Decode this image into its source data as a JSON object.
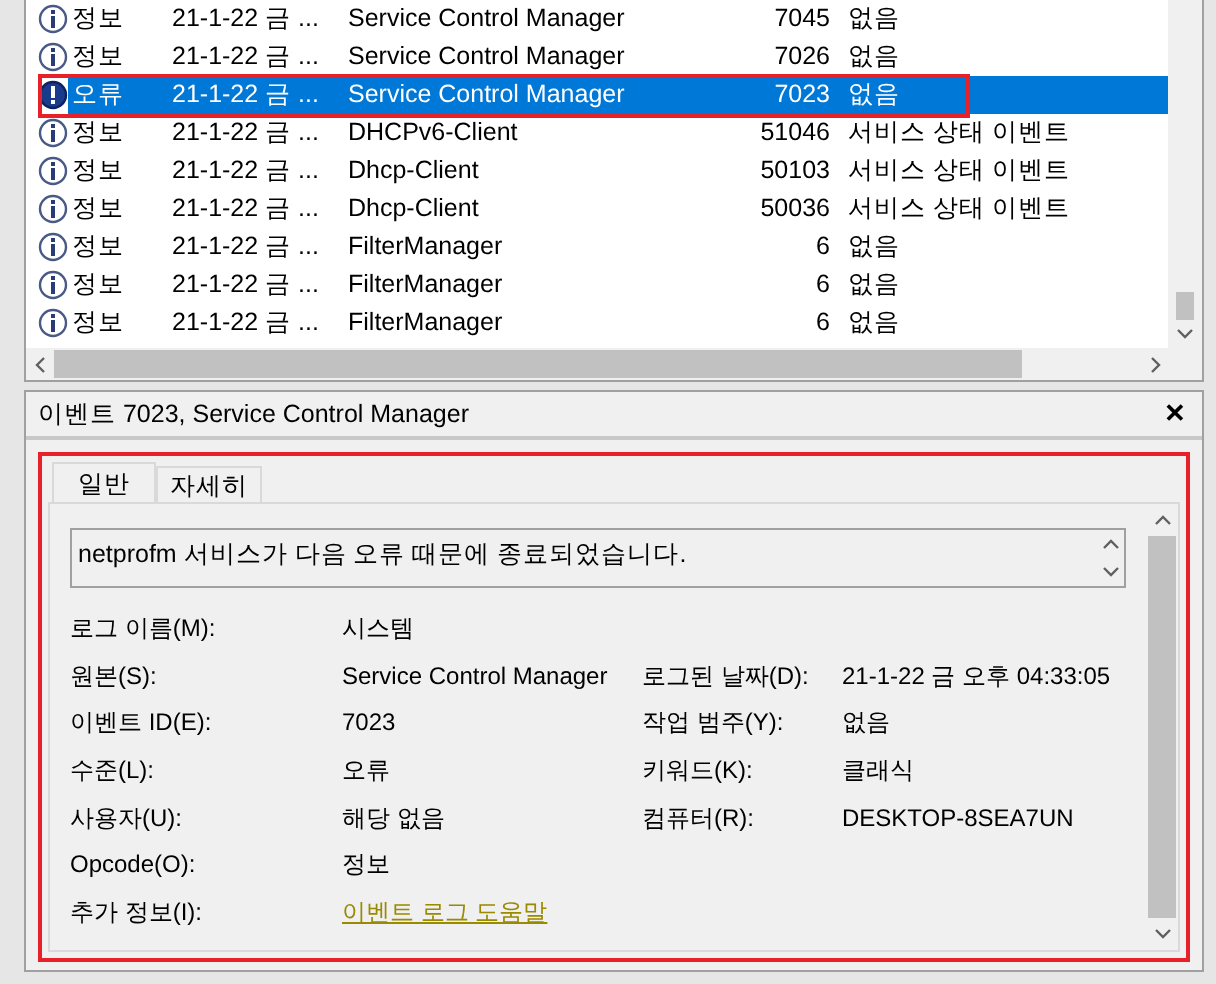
{
  "event_list": {
    "rows": [
      {
        "kind": "info",
        "level": "정보",
        "date": "21-1-22 금 ...",
        "source": "Service Control Manager",
        "event_id": "7045",
        "category": "없음",
        "selected": false
      },
      {
        "kind": "info",
        "level": "정보",
        "date": "21-1-22 금 ...",
        "source": "Service Control Manager",
        "event_id": "7026",
        "category": "없음",
        "selected": false
      },
      {
        "kind": "error",
        "level": "오류",
        "date": "21-1-22 금 ...",
        "source": "Service Control Manager",
        "event_id": "7023",
        "category": "없음",
        "selected": true
      },
      {
        "kind": "info",
        "level": "정보",
        "date": "21-1-22 금 ...",
        "source": "DHCPv6-Client",
        "event_id": "51046",
        "category": "서비스 상태 이벤트",
        "selected": false
      },
      {
        "kind": "info",
        "level": "정보",
        "date": "21-1-22 금 ...",
        "source": "Dhcp-Client",
        "event_id": "50103",
        "category": "서비스 상태 이벤트",
        "selected": false
      },
      {
        "kind": "info",
        "level": "정보",
        "date": "21-1-22 금 ...",
        "source": "Dhcp-Client",
        "event_id": "50036",
        "category": "서비스 상태 이벤트",
        "selected": false
      },
      {
        "kind": "info",
        "level": "정보",
        "date": "21-1-22 금 ...",
        "source": "FilterManager",
        "event_id": "6",
        "category": "없음",
        "selected": false
      },
      {
        "kind": "info",
        "level": "정보",
        "date": "21-1-22 금 ...",
        "source": "FilterManager",
        "event_id": "6",
        "category": "없음",
        "selected": false
      },
      {
        "kind": "info",
        "level": "정보",
        "date": "21-1-22 금 ...",
        "source": "FilterManager",
        "event_id": "6",
        "category": "없음",
        "selected": false
      }
    ]
  },
  "detail": {
    "title": "이벤트 7023, Service Control Manager",
    "close": "✕",
    "tabs": [
      {
        "label": "일반",
        "selected": true
      },
      {
        "label": "자세히",
        "selected": false
      }
    ],
    "message": "netprofm 서비스가 다음 오류 때문에 종료되었습니다.",
    "fields": [
      {
        "label": "로그 이름(M):",
        "value": "시스템"
      },
      {
        "label": "원본(S):",
        "value": "Service Control Manager",
        "label_2": "로그된 날짜(D):",
        "value_2": "21-1-22 금 오후 04:33:05"
      },
      {
        "label": "이벤트 ID(E):",
        "value": "7023",
        "label_2": "작업 범주(Y):",
        "value_2": "없음"
      },
      {
        "label": "수준(L):",
        "value": "오류",
        "label_2": "키워드(K):",
        "value_2": "클래식"
      },
      {
        "label": "사용자(U):",
        "value": "해당 없음",
        "label_2": "컴퓨터(R):",
        "value_2": "DESKTOP-8SEA7UN"
      },
      {
        "label": "Opcode(O):",
        "value": "정보"
      },
      {
        "label": "추가 정보(I):",
        "link": "이벤트 로그 도움말"
      }
    ]
  }
}
